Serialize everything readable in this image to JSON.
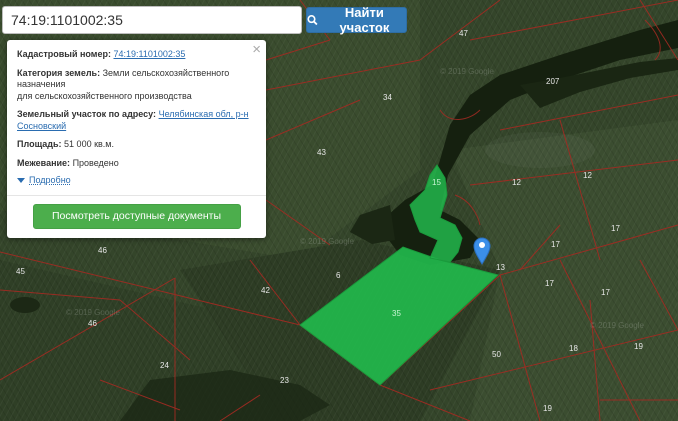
{
  "search": {
    "value": "74:19:1101002:35",
    "button_label": "Найти участок"
  },
  "popup": {
    "cadastral_label": "Кадастровый номер:",
    "cadastral_value": "74:19:1101002:35",
    "category_label": "Категория земель:",
    "category_value_1": "Земли сельскохозяйственного",
    "category_value_2": "назначения",
    "category_value_3": "для сельскохозяйственного производства",
    "address_label": "Земельный участок по адресу:",
    "address_value_1": "Челябинская обл, р-н",
    "address_value_2": "Сосновский",
    "area_label": "Площадь:",
    "area_value": "51 000 кв.м.",
    "survey_label": "Межевание:",
    "survey_value": "Проведено",
    "more_label": "Подробно",
    "docs_button_label": "Посмотреть доступные документы",
    "close_glyph": "×"
  },
  "map": {
    "plot_labels": [
      "47",
      "207",
      "34",
      "43",
      "12",
      "12",
      "17",
      "17",
      "17",
      "17",
      "13",
      "46",
      "6",
      "42",
      "45",
      "46",
      "35",
      "24",
      "23",
      "50",
      "19",
      "19",
      "18",
      "15"
    ],
    "watermark": "© 2019 Google",
    "colors": {
      "selected_fill": "#22b84c",
      "boundary": "#a42a22",
      "marker": "#3b8fe8"
    }
  }
}
